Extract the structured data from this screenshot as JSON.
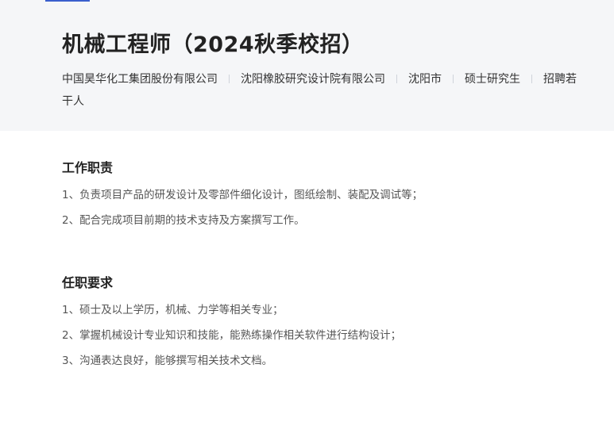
{
  "job": {
    "title": "机械工程师（2024秋季校招）",
    "meta": [
      "中国昊华化工集团股份有限公司",
      "沈阳橡胶研究设计院有限公司",
      "沈阳市",
      "硕士研究生",
      "招聘若干人"
    ]
  },
  "responsibilities": {
    "heading": "工作职责",
    "items": [
      "1、负责项目产品的研发设计及零部件细化设计，图纸绘制、装配及调试等；",
      "2、配合完成项目前期的技术支持及方案撰写工作。"
    ]
  },
  "requirements": {
    "heading": "任职要求",
    "items": [
      "1、硕士及以上学历，机械、力学等相关专业；",
      "2、掌握机械设计专业知识和技能，能熟练操作相关软件进行结构设计；",
      "3、沟通表达良好，能够撰写相关技术文档。"
    ]
  },
  "colors": {
    "header_bg": "#f5f6f8",
    "accent": "#3a5fcd"
  }
}
